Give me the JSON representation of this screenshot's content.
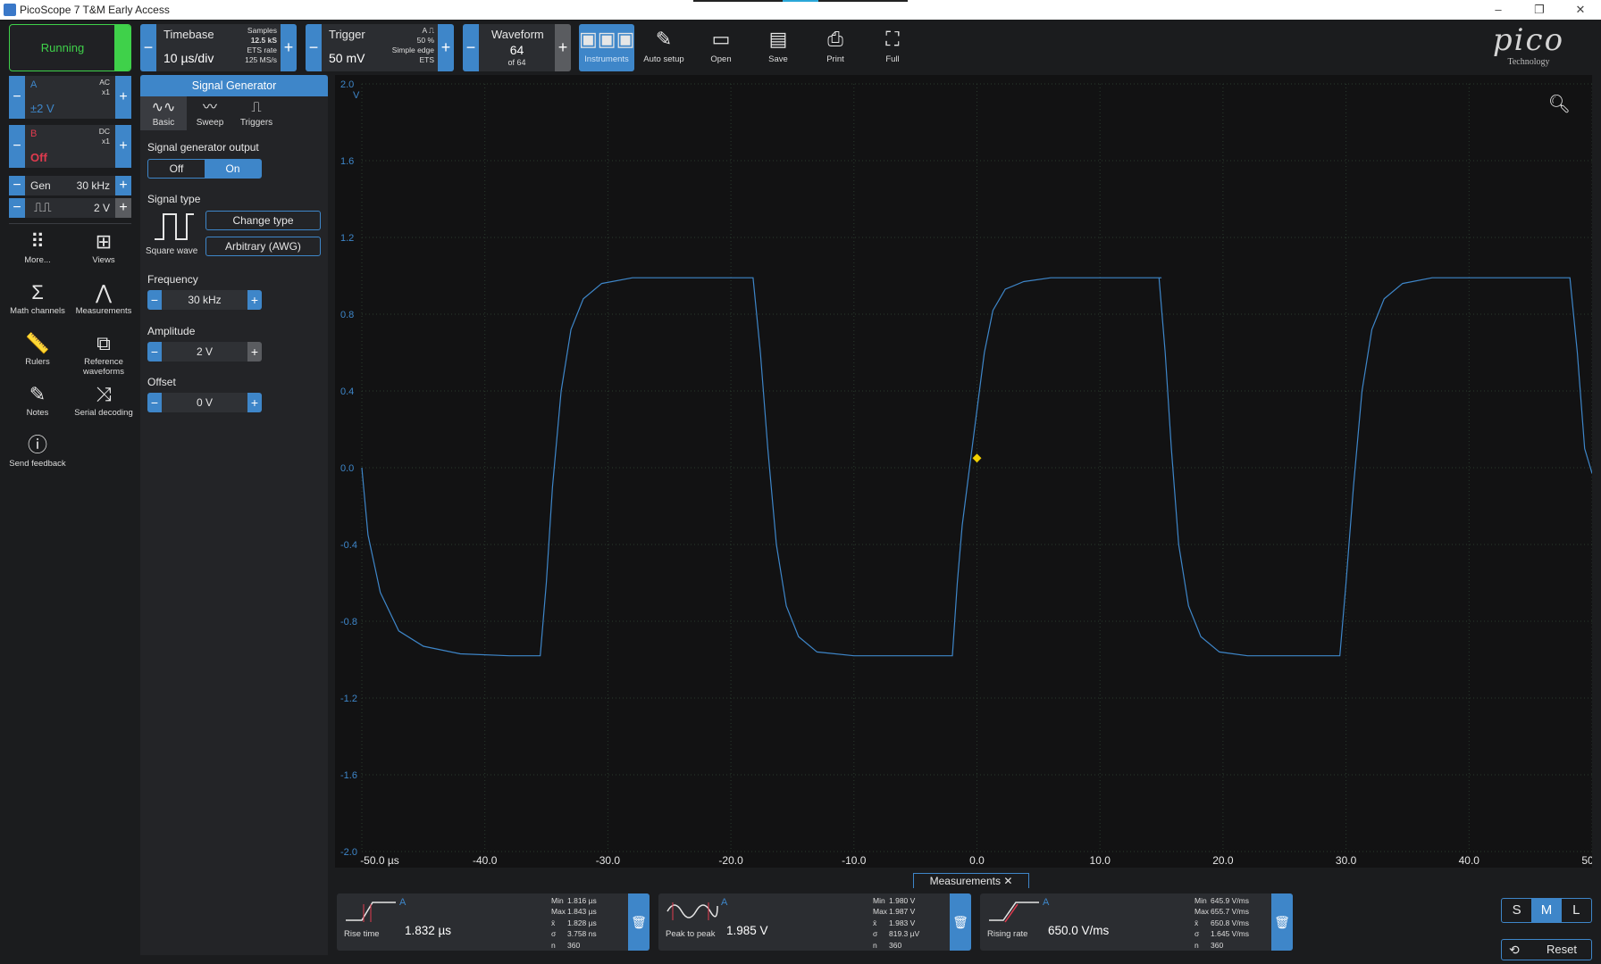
{
  "window": {
    "title": "PicoScope 7 T&M Early Access"
  },
  "toolbar": {
    "run_label": "Running",
    "timebase": {
      "label": "Timebase",
      "value": "10 µs/div",
      "samples_lbl": "Samples",
      "samples_val": "12.5 kS",
      "ets_rate_lbl": "ETS rate",
      "ets_rate_val": "125 MS/s"
    },
    "trigger": {
      "label": "Trigger",
      "value": "50 mV",
      "channel": "A",
      "level": "50 %",
      "type": "Simple edge",
      "mode": "ETS"
    },
    "waveform": {
      "label": "Waveform",
      "value": "64",
      "of": "of 64"
    },
    "buttons": {
      "instruments": "Instruments",
      "auto_setup": "Auto setup",
      "open": "Open",
      "save": "Save",
      "print": "Print",
      "full": "Full"
    },
    "brand": {
      "word": "pico",
      "sub": "Technology"
    }
  },
  "channels": [
    {
      "name": "A",
      "coupling": "AC",
      "probe": "x1",
      "range": "±2 V",
      "color": "#3e86c9"
    },
    {
      "name": "B",
      "coupling": "DC",
      "probe": "x1",
      "range": "Off",
      "color": "#e03a4e"
    }
  ],
  "gen_mini": {
    "label": "Gen",
    "freq": "30 kHz",
    "amp": "2 V"
  },
  "left_tools": {
    "more": "More...",
    "views": "Views",
    "math": "Math channels",
    "measurements": "Measurements",
    "rulers": "Rulers",
    "reference": "Reference waveforms",
    "notes": "Notes",
    "serial": "Serial decoding",
    "feedback": "Send feedback"
  },
  "signal_generator": {
    "header": "Signal Generator",
    "tabs": {
      "basic": "Basic",
      "sweep": "Sweep",
      "triggers": "Triggers"
    },
    "output_label": "Signal generator output",
    "off": "Off",
    "on": "On",
    "type_label": "Signal type",
    "wave_name": "Square wave",
    "change_type": "Change type",
    "awg": "Arbitrary (AWG)",
    "frequency_label": "Frequency",
    "frequency": "30 kHz",
    "amplitude_label": "Amplitude",
    "amplitude": "2 V",
    "offset_label": "Offset",
    "offset": "0 V"
  },
  "chart_data": {
    "type": "line",
    "title": "",
    "xlabel": "",
    "ylabel": "",
    "xlim": [
      -50,
      50
    ],
    "ylim": [
      -2.0,
      2.0
    ],
    "x_ticks": [
      "-50.0 µs",
      "-40.0",
      "-30.0",
      "-20.0",
      "-10.0",
      "0.0",
      "10.0",
      "20.0",
      "30.0",
      "40.0",
      "50.0"
    ],
    "x_tick_values": [
      -50,
      -40,
      -30,
      -20,
      -10,
      0,
      10,
      20,
      30,
      40,
      50
    ],
    "y_ticks": [
      "2.0",
      "1.6",
      "1.2",
      "0.8",
      "0.4",
      "0.0",
      "-0.4",
      "-0.8",
      "-1.2",
      "-1.6",
      "-2.0"
    ],
    "y_tick_values": [
      2.0,
      1.6,
      1.2,
      0.8,
      0.4,
      0.0,
      -0.4,
      -0.8,
      -1.2,
      -1.6,
      -2.0
    ],
    "y_unit": "V",
    "grid": true,
    "series": [
      {
        "color": "#3e86c9",
        "x": [
          -50,
          -49.5,
          -48.5,
          -47,
          -45,
          -42,
          -38,
          -35.5,
          -35.0,
          -34.5,
          -33.8,
          -33.0,
          -32.0,
          -30.5,
          -28,
          -24,
          -20.5,
          -18.2,
          -17.6,
          -17.0,
          -16.3,
          -15.5,
          -14.5,
          -13.0,
          -10,
          -6,
          -2.0,
          -1.6,
          -1.2,
          -0.6,
          0.0,
          0.6,
          1.3,
          2.3,
          3.8,
          6,
          10,
          15,
          14.8,
          15.3,
          15.8,
          16.4,
          17.2,
          18.2,
          19.7,
          22,
          26,
          29.5,
          30.0,
          30.6,
          31.3,
          32.1,
          33.1,
          34.6,
          37,
          41,
          44,
          48.2,
          48.8,
          49.4,
          50
        ],
        "y": [
          0.0,
          -0.35,
          -0.65,
          -0.85,
          -0.93,
          -0.97,
          -0.98,
          -0.98,
          -0.6,
          -0.1,
          0.4,
          0.72,
          0.88,
          0.96,
          0.99,
          0.99,
          0.99,
          0.99,
          0.6,
          0.1,
          -0.4,
          -0.72,
          -0.88,
          -0.96,
          -0.98,
          -0.98,
          -0.98,
          -0.6,
          -0.3,
          0.0,
          0.3,
          0.6,
          0.82,
          0.93,
          0.97,
          0.99,
          0.99,
          0.99,
          0.99,
          0.6,
          0.1,
          -0.4,
          -0.72,
          -0.88,
          -0.96,
          -0.98,
          -0.98,
          -0.98,
          -0.6,
          -0.1,
          0.4,
          0.72,
          0.88,
          0.96,
          0.99,
          0.99,
          0.99,
          0.99,
          0.6,
          0.1,
          -0.03
        ]
      }
    ],
    "trigger_marker": {
      "x": 0.0,
      "y": 0.05
    }
  },
  "measurements": {
    "header": "Measurements",
    "items": [
      {
        "channel": "A",
        "name": "Rise time",
        "value": "1.832 µs",
        "min": "1.816 µs",
        "max": "1.843 µs",
        "mean": "1.828 µs",
        "sd": "3.758 ns",
        "n": "360"
      },
      {
        "channel": "A",
        "name": "Peak to peak",
        "value": "1.985 V",
        "min": "1.980 V",
        "max": "1.987 V",
        "mean": "1.983 V",
        "sd": "819.3 µV",
        "n": "360"
      },
      {
        "channel": "A",
        "name": "Rising rate",
        "value": "650.0 V/ms",
        "min": "645.9 V/ms",
        "max": "655.7 V/ms",
        "mean": "650.8 V/ms",
        "sd": "1.645 V/ms",
        "n": "360"
      }
    ],
    "stat_labels": {
      "min": "Min",
      "max": "Max",
      "mean": "x̄",
      "sd": "σ",
      "n": "n"
    }
  },
  "size_buttons": {
    "s": "S",
    "m": "M",
    "l": "L"
  },
  "reset_label": "Reset"
}
